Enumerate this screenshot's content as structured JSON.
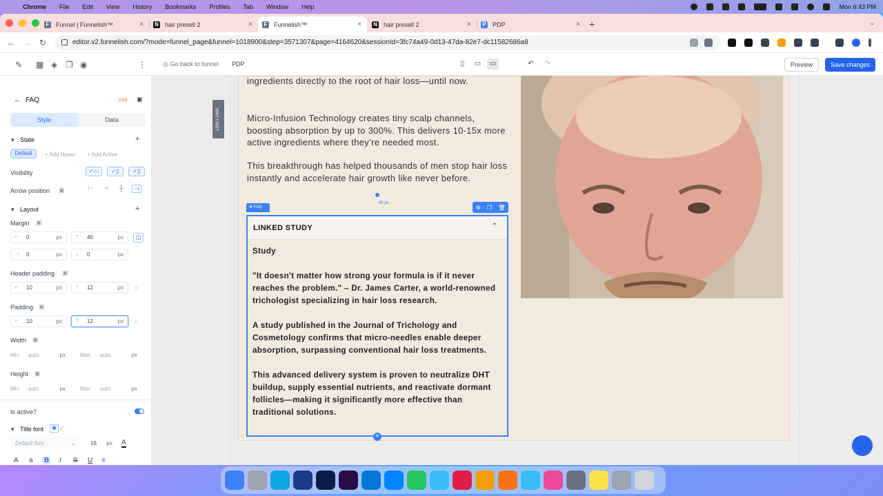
{
  "menubar": {
    "app": "Chrome",
    "items": [
      "File",
      "Edit",
      "View",
      "History",
      "Bookmarks",
      "Profiles",
      "Tab",
      "Window",
      "Help"
    ],
    "clock": "Mon 6:43 PM"
  },
  "tabs": [
    {
      "title": "Funnel | Funnelish™",
      "fav": "F"
    },
    {
      "title": "hair presell 2",
      "fav": "N"
    },
    {
      "title": "Funnelish™",
      "fav": "F"
    },
    {
      "title": "hair presell 2",
      "fav": "N"
    },
    {
      "title": "PDP",
      "fav": "P"
    }
  ],
  "address": {
    "url": "editor.v2.funnelish.com/?mode=funnel_page&funnel=1018900&step=3571307&page=4164620&sessionId=3fc74a49-0d13-47da-82e7-dc11582686a8"
  },
  "toolbar": {
    "back_label": "Go back to funnel",
    "page_name": "PDP",
    "preview": "Preview",
    "save": "Save changes"
  },
  "panel": {
    "title": "FAQ",
    "css_tag": ".css",
    "tab_style": "Style",
    "tab_data": "Data",
    "state_label": "State",
    "state_default": "Default",
    "add_hover": "+ Add Hover",
    "add_active": "+ Add Active",
    "visibility": "Visibility",
    "arrow_position": "Arrow position",
    "layout": "Layout",
    "margin": "Margin",
    "margin_left": "0",
    "margin_top": "40",
    "margin_right": "0",
    "margin_bottom": "0",
    "header_padding": "Header padding",
    "hp_h": "10",
    "hp_v": "12",
    "padding": "Padding",
    "p_h": "10",
    "p_v": "12",
    "width": "Width",
    "height": "Height",
    "min": "Min",
    "max": "Max",
    "auto": "auto",
    "px": "px",
    "is_active": "Is active?",
    "title_font": "Title font",
    "default_font": "Default font",
    "font_size": "16"
  },
  "canvas": {
    "size_tag": "1200 x 2400",
    "para1": "ingredients directly to the root of hair loss—until now.",
    "para2": "Micro-Infusion Technology creates tiny scalp channels, boosting absorption by up to 300%. This delivers 10-15x more active ingredients where they’re needed most.",
    "para3": "This breakthrough has helped thousands of men stop hair loss instantly and accelerate hair growth like never before.",
    "faq_tag": "FAQ",
    "margin_label": "40 px",
    "faq_title": "LINKED STUDY",
    "faq_p1": "Study",
    "faq_p2": "\"It doesn't matter how strong your formula is if it never reaches the problem.\" – Dr. James Carter, a world-renowned trichologist specializing in hair loss research.",
    "faq_p3": "A study published in the Journal of Trichology and Cosmetology confirms that micro-needles enable deeper absorption, surpassing conventional hair loss treatments.",
    "faq_p4": "This advanced delivery system is proven to neutralize DHT buildup, supply essential nutrients, and reactivate dormant follicles—making it significantly more effective than traditional solutions."
  },
  "colors": {
    "accent": "#2563eb",
    "page_bg": "#f2e9df",
    "tabstrip": "#f8dede"
  }
}
